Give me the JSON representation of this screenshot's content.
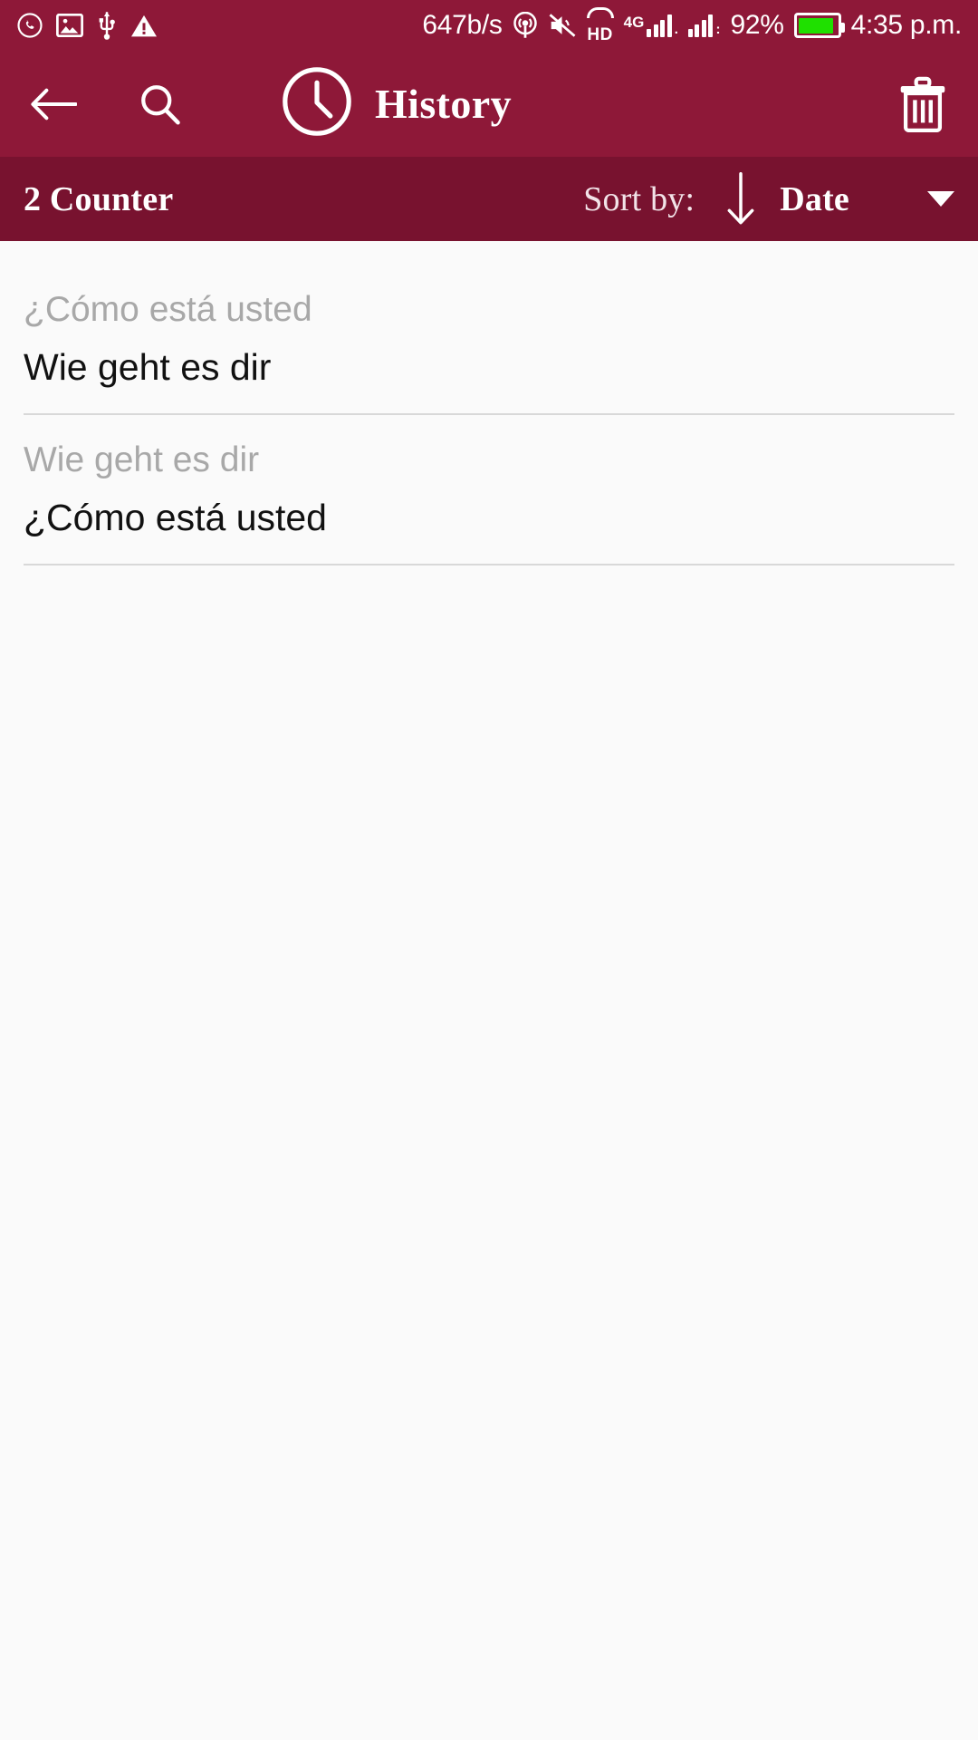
{
  "statusbar": {
    "left_icons": [
      "whatsapp-icon",
      "image-icon",
      "usb-icon",
      "warning-icon"
    ],
    "network_speed": "647b/s",
    "icons": [
      "hotspot-icon",
      "mute-icon",
      "hd-voice-icon"
    ],
    "hd_label": "HD",
    "network_type": "4G",
    "battery_percent": "92%",
    "battery_level": 92,
    "time": "4:35 p.m."
  },
  "appbar": {
    "back_label": "back-arrow",
    "search_label": "search",
    "title": "History",
    "clock_icon": "clock-icon",
    "delete_label": "delete-all"
  },
  "sortbar": {
    "counter": "2 Counter",
    "sort_by_label": "Sort by:",
    "sort_direction": "descending",
    "sort_value": "Date",
    "caret": "dropdown-caret"
  },
  "history": {
    "items": [
      {
        "source": "¿Cómo está usted",
        "target": "Wie geht es dir"
      },
      {
        "source": "Wie geht es dir",
        "target": "¿Cómo está usted"
      }
    ]
  },
  "colors": {
    "primary": "#8e1838",
    "primary_dark": "#78122f",
    "background": "#fafafa",
    "battery_green": "#1fe000",
    "muted_text": "#a8a8a8",
    "body_text": "#111111"
  }
}
